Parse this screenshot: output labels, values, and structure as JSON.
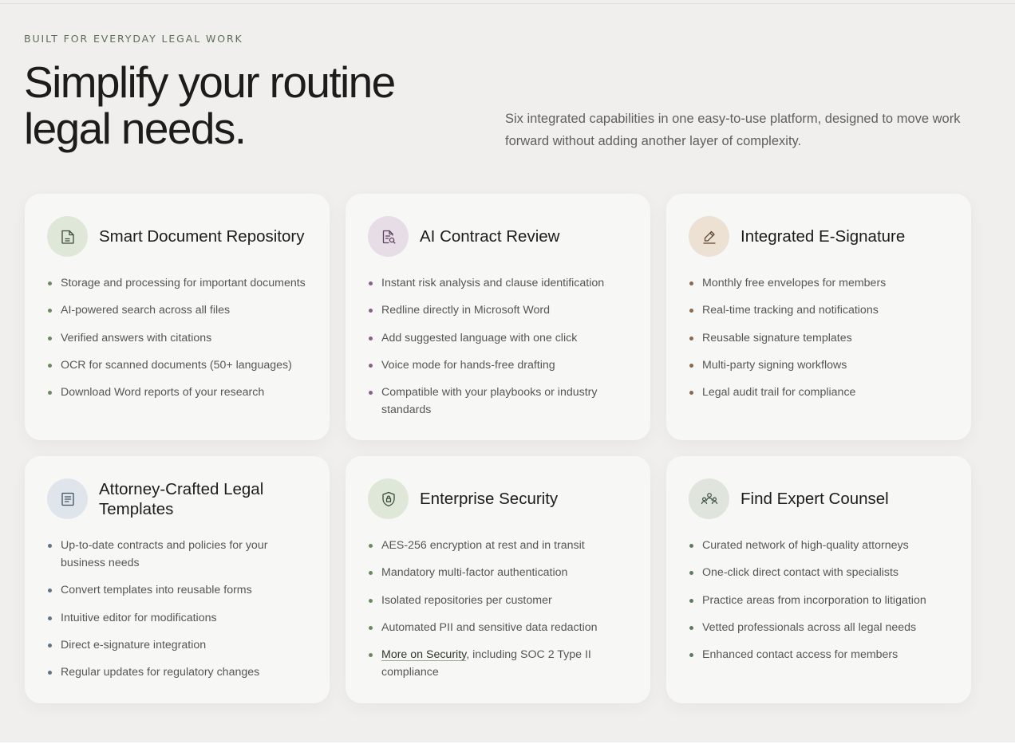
{
  "hero": {
    "eyebrow": "BUILT FOR EVERYDAY LEGAL WORK",
    "headline": "Simplify your routine legal needs.",
    "lede": "Six integrated capabilities in one easy-to-use platform, designed to move work forward without adding another layer of complexity."
  },
  "cards": [
    {
      "title": "Smart Document Repository",
      "icon": "document-icon",
      "icon_bg": "#dfe8d8",
      "dot_color": "#6b8a5e",
      "items": [
        "Storage and processing for important documents",
        "AI-powered search across all files",
        "Verified answers with citations",
        "OCR for scanned documents (50+ languages)",
        "Download Word reports of your research"
      ]
    },
    {
      "title": "AI Contract Review",
      "icon": "document-search-icon",
      "icon_bg": "#e7dde7",
      "dot_color": "#8a5f8a",
      "items": [
        "Instant risk analysis and clause identification",
        "Redline directly in Microsoft Word",
        "Add suggested language with one click",
        "Voice mode for hands-free drafting",
        "Compatible with your playbooks or industry standards"
      ]
    },
    {
      "title": "Integrated E-Signature",
      "icon": "pen-icon",
      "icon_bg": "#ece1d2",
      "dot_color": "#8a6a4a",
      "items": [
        "Monthly free envelopes for members",
        "Real-time tracking and notifications",
        "Reusable signature templates",
        "Multi-party signing workflows",
        "Legal audit trail for compliance"
      ]
    },
    {
      "title": "Attorney-Crafted Legal Templates",
      "icon": "template-icon",
      "icon_bg": "#dfe5ea",
      "dot_color": "#5e7487",
      "items": [
        "Up-to-date contracts and policies for your business needs",
        "Convert templates into reusable forms",
        "Intuitive editor for modifications",
        "Direct e-signature integration",
        "Regular updates for regulatory changes"
      ]
    },
    {
      "title": "Enterprise Security",
      "icon": "shield-lock-icon",
      "icon_bg": "#dfe8d8",
      "dot_color": "#6b8a5e",
      "items": [
        "AES-256 encryption at rest and in transit",
        "Mandatory multi-factor authentication",
        "Isolated repositories per customer",
        "Automated PII and sensitive data redaction"
      ],
      "last_item": {
        "link": "More on Security",
        "rest": ", including SOC 2 Type II compliance"
      }
    },
    {
      "title": "Find Expert Counsel",
      "icon": "people-network-icon",
      "icon_bg": "#dfe5dc",
      "dot_color": "#5f7a62",
      "items": [
        "Curated network of high-quality attorneys",
        "One-click direct contact with specialists",
        "Practice areas from incorporation to litigation",
        "Vetted professionals across all legal needs",
        "Enhanced contact access for members"
      ]
    }
  ]
}
